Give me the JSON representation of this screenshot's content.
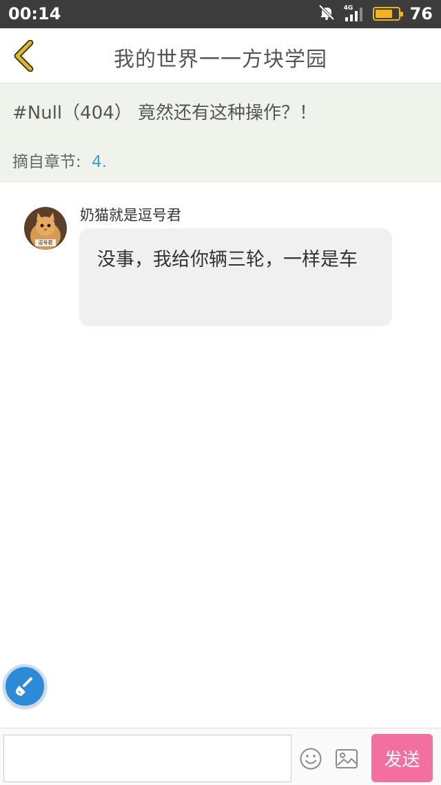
{
  "status_bar": {
    "time": "00:14",
    "network": "4G",
    "battery": "76",
    "battery_level": 0.76,
    "icons": [
      "mute-icon",
      "signal-icon",
      "battery-icon"
    ]
  },
  "header": {
    "title": "我的世界一一方块学园",
    "back_icon": "chevron-left-icon",
    "accent": "#e0b62a"
  },
  "quote": {
    "text": "#Null（404） 竟然还有这种操作？！",
    "chapter_label": "摘自章节:",
    "chapter_value": "4."
  },
  "message": {
    "username": "奶猫就是逗号君",
    "avatar_caption": "逗号君",
    "text": "没事，我给你辆三轮，一样是车"
  },
  "input": {
    "placeholder": "",
    "value": "",
    "emoji_icon": "smiley-icon",
    "image_icon": "image-icon",
    "send_label": "发送",
    "send_color": "#f36fa0"
  },
  "fab": {
    "icon": "brush-icon",
    "color": "#2c8ad6"
  }
}
